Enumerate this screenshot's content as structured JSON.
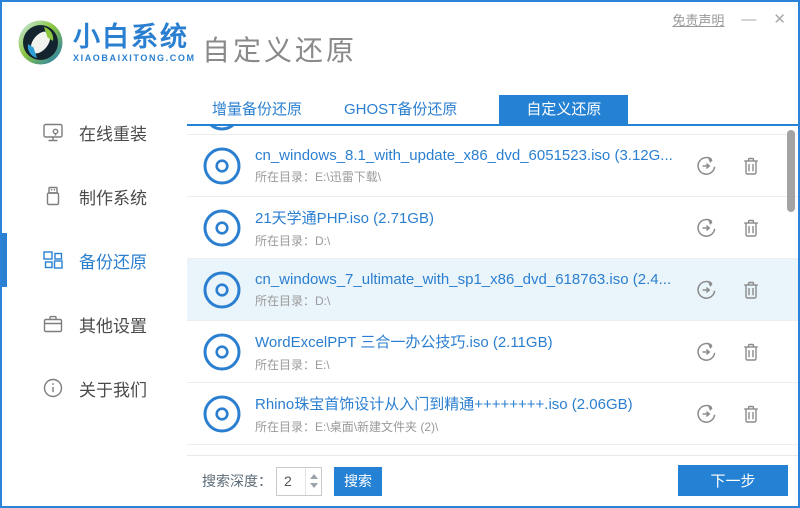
{
  "window": {
    "disclaimer": "免责声明",
    "minimize_glyph": "—",
    "close_glyph": "✕"
  },
  "header": {
    "brand_name": "小白系统",
    "brand_domain": "XIAOBAIXITONG.COM",
    "page_title": "自定义还原"
  },
  "sidebar": {
    "items": [
      {
        "label": "在线重装",
        "icon": "monitor-icon",
        "active": false
      },
      {
        "label": "制作系统",
        "icon": "usb-icon",
        "active": false
      },
      {
        "label": "备份还原",
        "icon": "grid-icon",
        "active": true
      },
      {
        "label": "其他设置",
        "icon": "briefcase-icon",
        "active": false
      },
      {
        "label": "关于我们",
        "icon": "info-icon",
        "active": false
      }
    ]
  },
  "tabs": [
    {
      "label": "增量备份还原",
      "active": false
    },
    {
      "label": "GHOST备份还原",
      "active": false
    },
    {
      "label": "自定义还原",
      "active": true
    }
  ],
  "list": {
    "dir_label": "所在目录：",
    "items": [
      {
        "title": "cn_windows_8.1_with_update_x86_dvd_6051523.iso (3.12G...",
        "directory": "E:\\迅雷下载\\",
        "selected": false
      },
      {
        "title": "21天学通PHP.iso (2.71GB)",
        "directory": "D:\\",
        "selected": false
      },
      {
        "title": "cn_windows_7_ultimate_with_sp1_x86_dvd_618763.iso (2.4...",
        "directory": "D:\\",
        "selected": true
      },
      {
        "title": "WordExcelPPT 三合一办公技巧.iso (2.11GB)",
        "directory": "E:\\",
        "selected": false
      },
      {
        "title": "Rhino珠宝首饰设计从入门到精通++++++++.iso (2.06GB)",
        "directory": "E:\\桌面\\新建文件夹 (2)\\",
        "selected": false
      }
    ],
    "row_icons": {
      "file": "disc-icon",
      "restore": "restore-icon",
      "delete": "trash-icon"
    }
  },
  "footer": {
    "search_depth_label": "搜索深度：",
    "search_depth_value": "2",
    "search_button": "搜索",
    "next_button": "下一步"
  },
  "colors": {
    "accent": "#2581d3",
    "link_blue": "#2b7fd0",
    "selected_row_bg": "#eaf4fb",
    "title_gray": "#8a8a8a"
  }
}
